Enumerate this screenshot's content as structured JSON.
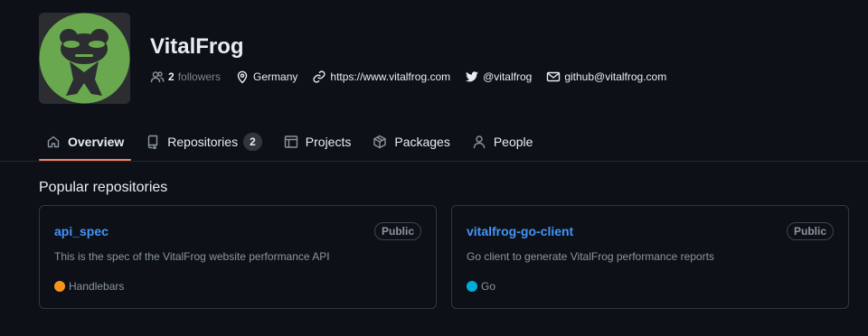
{
  "profile": {
    "name": "VitalFrog",
    "avatar_bg": "#6aa84f",
    "meta": {
      "followers_count": "2",
      "followers_label": "followers",
      "location": "Germany",
      "website": "https://www.vitalfrog.com",
      "twitter": "@vitalfrog",
      "email": "github@vitalfrog.com"
    }
  },
  "tabs": [
    {
      "label": "Overview",
      "icon": "home-icon",
      "active": true
    },
    {
      "label": "Repositories",
      "icon": "repo-icon",
      "counter": "2"
    },
    {
      "label": "Projects",
      "icon": "table-icon"
    },
    {
      "label": "Packages",
      "icon": "package-icon"
    },
    {
      "label": "People",
      "icon": "person-icon"
    }
  ],
  "popular": {
    "title": "Popular repositories",
    "repos": [
      {
        "name": "api_spec",
        "visibility": "Public",
        "description": "This is the spec of the VitalFrog website performance API",
        "language": "Handlebars",
        "language_color": "#f7931e"
      },
      {
        "name": "vitalfrog-go-client",
        "visibility": "Public",
        "description": "Go client to generate VitalFrog performance reports",
        "language": "Go",
        "language_color": "#00add8"
      }
    ]
  },
  "colors": {
    "background": "#0d1117",
    "link": "#4493f8",
    "active_tab_underline": "#f78166"
  }
}
